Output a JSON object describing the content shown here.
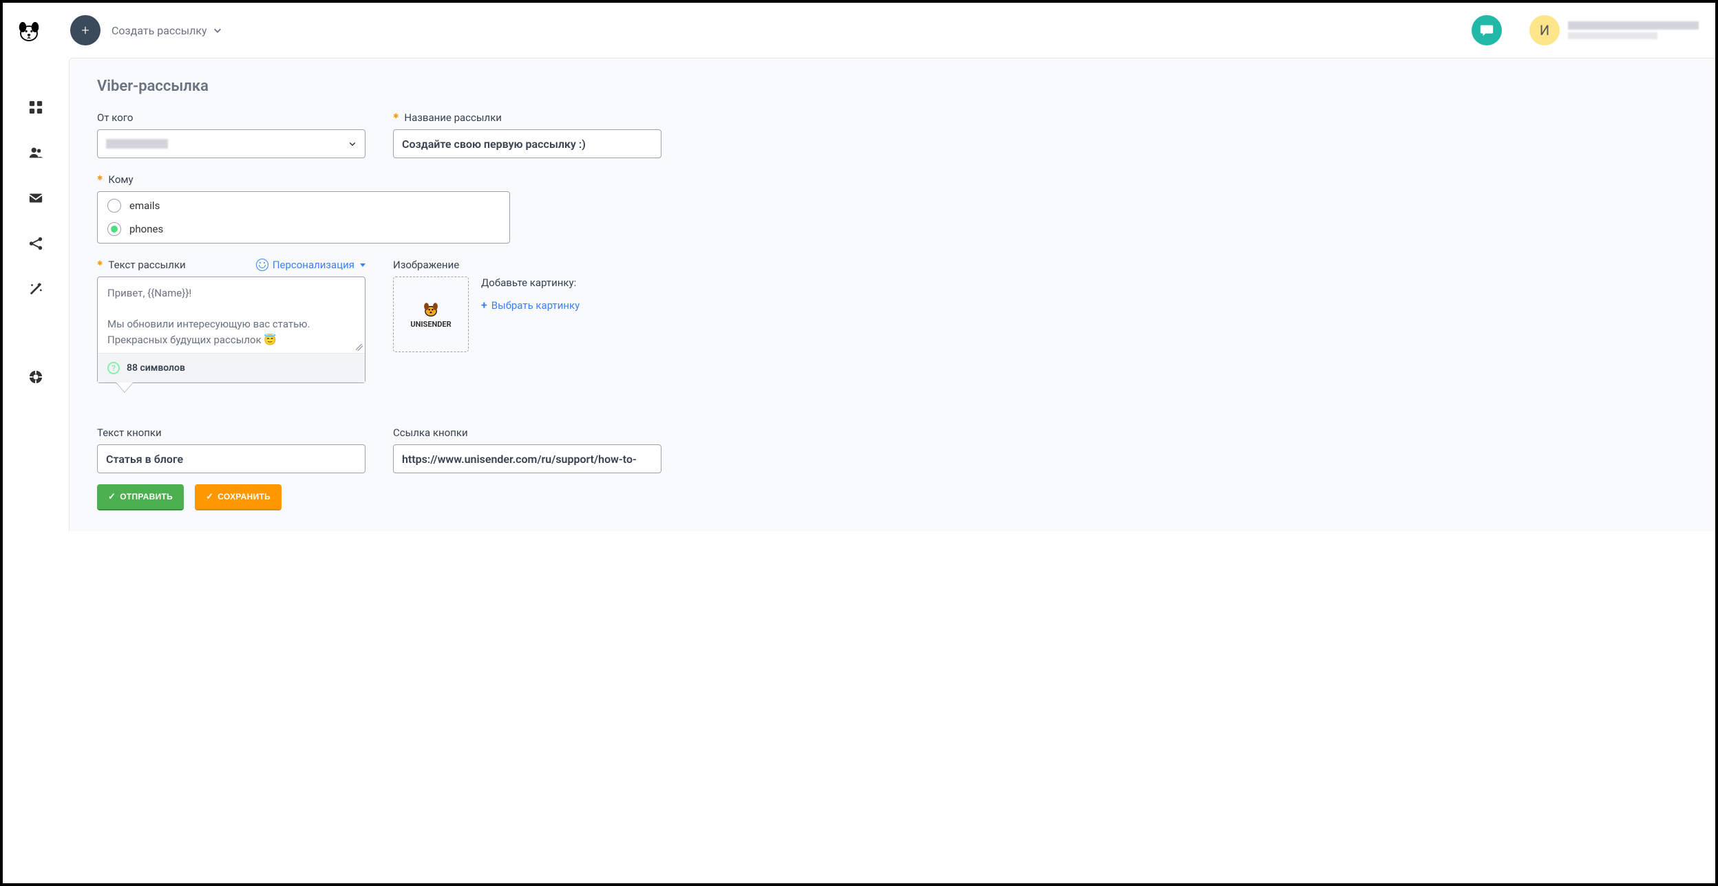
{
  "header": {
    "create_label": "Создать рассылку",
    "avatar_letter": "И"
  },
  "page": {
    "title": "Viber-рассылка"
  },
  "labels": {
    "from": "От кого",
    "campaign_name": "Название рассылки",
    "to": "Кому",
    "text": "Текст рассылки",
    "personalization": "Персонализация",
    "image": "Изображение",
    "add_image": "Добавьте картинку:",
    "choose_image": "Выбрать картинку",
    "button_text": "Текст кнопки",
    "button_link": "Ссылка кнопки"
  },
  "values": {
    "campaign_name": "Создайте свою первую рассылку :)",
    "recipient_options": {
      "emails": "emails",
      "phones": "phones"
    },
    "recipient_selected": "phones",
    "message_text": "Привет, {{Name}}!\n\nМы обновили интересующую вас статью. Прекрасных будущих рассылок 😇",
    "char_count": "88 символов",
    "image_thumb_label": "UNISENDER",
    "button_text": "Статья в блоге",
    "button_link": "https://www.unisender.com/ru/support/how-to-"
  },
  "actions": {
    "send": "ОТПРАВИТЬ",
    "save": "СОХРАНИТЬ"
  }
}
